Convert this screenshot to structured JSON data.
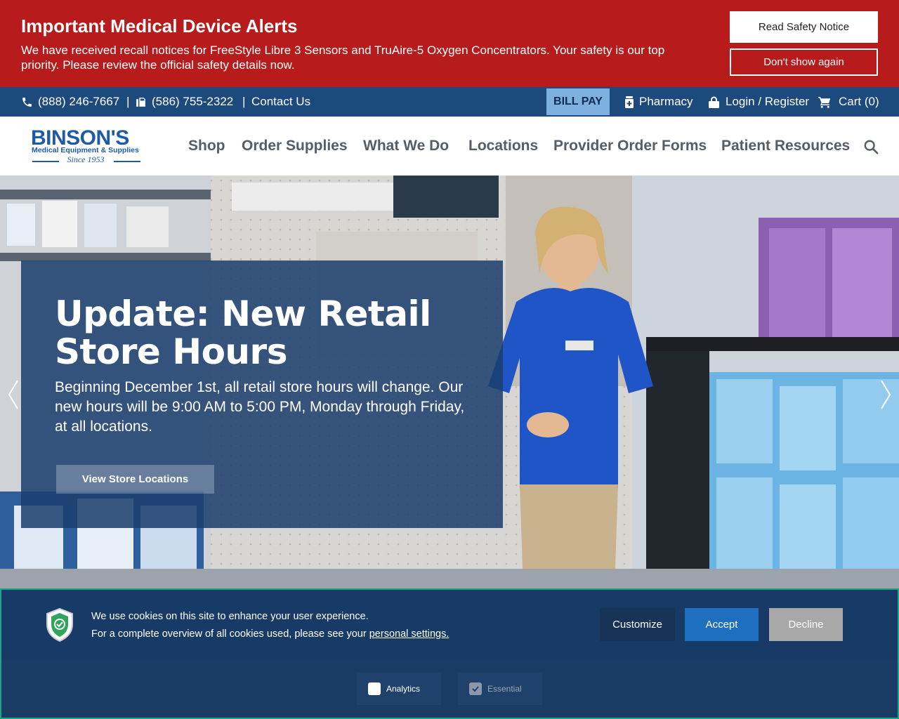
{
  "alert": {
    "title": "Important Medical Device Alerts",
    "text": "We have received recall notices for FreeStyle Libre 3 Sensors and TruAire-5 Oxygen Concentrators. Your safety is our top priority. Please review the official safety details now.",
    "primary_button": "Read Safety Notice",
    "secondary_button": "Don't show again"
  },
  "utility": {
    "phone1": "(888) 246-7667",
    "separator": "|",
    "phone2": "(586) 755-2322",
    "contact": "Contact Us",
    "bill_pay": "BILL PAY",
    "pharmacy": "Pharmacy",
    "login": "Login / Register",
    "cart": "Cart (0)"
  },
  "logo": {
    "name": "BINSON'S",
    "sub": "Medical Equipment & Supplies",
    "since": "Since 1953"
  },
  "nav": {
    "items": [
      "Shop",
      "Order Supplies",
      "What We Do",
      "Locations",
      "Provider Order Forms",
      "Patient Resources"
    ]
  },
  "hero": {
    "title": "Update: New Retail Store Hours",
    "text": "Beginning December 1st, all retail store hours will change. Our new hours will be 9:00 AM to 5:00 PM, Monday through Friday, at all locations.",
    "button": "View Store Locations"
  },
  "cookie": {
    "line1": "We use cookies on this site to enhance your user experience.",
    "line2_prefix": "For a complete overview of all cookies used, please see your ",
    "line2_link": "personal settings.",
    "customize": "Customize",
    "accept": "Accept",
    "decline": "Decline",
    "analytics": "Analytics",
    "essential": "Essential"
  },
  "colors": {
    "alert_bg": "#b81b1b",
    "utility_bg": "#1d4a7d",
    "brand_blue": "#1f5aa6",
    "accept_blue": "#1f6fc0"
  }
}
